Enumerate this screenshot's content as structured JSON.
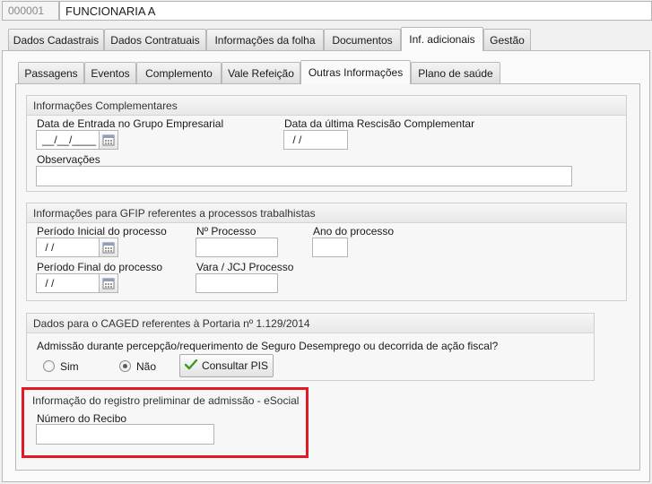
{
  "header": {
    "code": "000001",
    "employee_name": "FUNCIONARIA A"
  },
  "main_tabs": [
    {
      "label": "Dados Cadastrais"
    },
    {
      "label": "Dados Contratuais"
    },
    {
      "label": "Informações da folha"
    },
    {
      "label": "Documentos"
    },
    {
      "label": "Inf. adicionais"
    },
    {
      "label": "Gestão"
    }
  ],
  "sub_tabs": [
    {
      "label": "Passagens"
    },
    {
      "label": "Eventos"
    },
    {
      "label": "Complemento"
    },
    {
      "label": "Vale Refeição"
    },
    {
      "label": "Outras Informações"
    },
    {
      "label": "Plano de saúde"
    }
  ],
  "info_complementares": {
    "title": "Informações Complementares",
    "data_entrada_label": "Data de Entrada no Grupo Empresarial",
    "data_entrada_value": "__/__/____",
    "data_rescisao_label": "Data da última Rescisão Complementar",
    "data_rescisao_value": " / /",
    "observacoes_label": "Observações",
    "observacoes_value": ""
  },
  "gfip": {
    "title": "Informações para GFIP referentes a processos trabalhistas",
    "periodo_inicial_label": "Período Inicial do processo",
    "periodo_inicial_value": " / /",
    "n_processo_label": "Nº Processo",
    "n_processo_value": "",
    "ano_processo_label": "Ano do processo",
    "ano_processo_value": "",
    "periodo_final_label": "Período Final do processo",
    "periodo_final_value": " / /",
    "vara_label": "Vara / JCJ Processo",
    "vara_value": ""
  },
  "caged": {
    "title": "Dados para o CAGED referentes à Portaria nº 1.129/2014",
    "question": "Admissão durante percepção/requerimento de Seguro Desemprego ou decorrida de ação fiscal?",
    "option_sim": "Sim",
    "option_nao": "Não",
    "selected": "Não",
    "consultar_button": "Consultar PIS"
  },
  "esocial": {
    "title": "Informação do registro preliminar de admissão - eSocial",
    "recibo_label": "Número do Recibo",
    "recibo_value": ""
  },
  "colors": {
    "highlight_border": "#e01b24",
    "check_green": "#3a9a1e"
  }
}
